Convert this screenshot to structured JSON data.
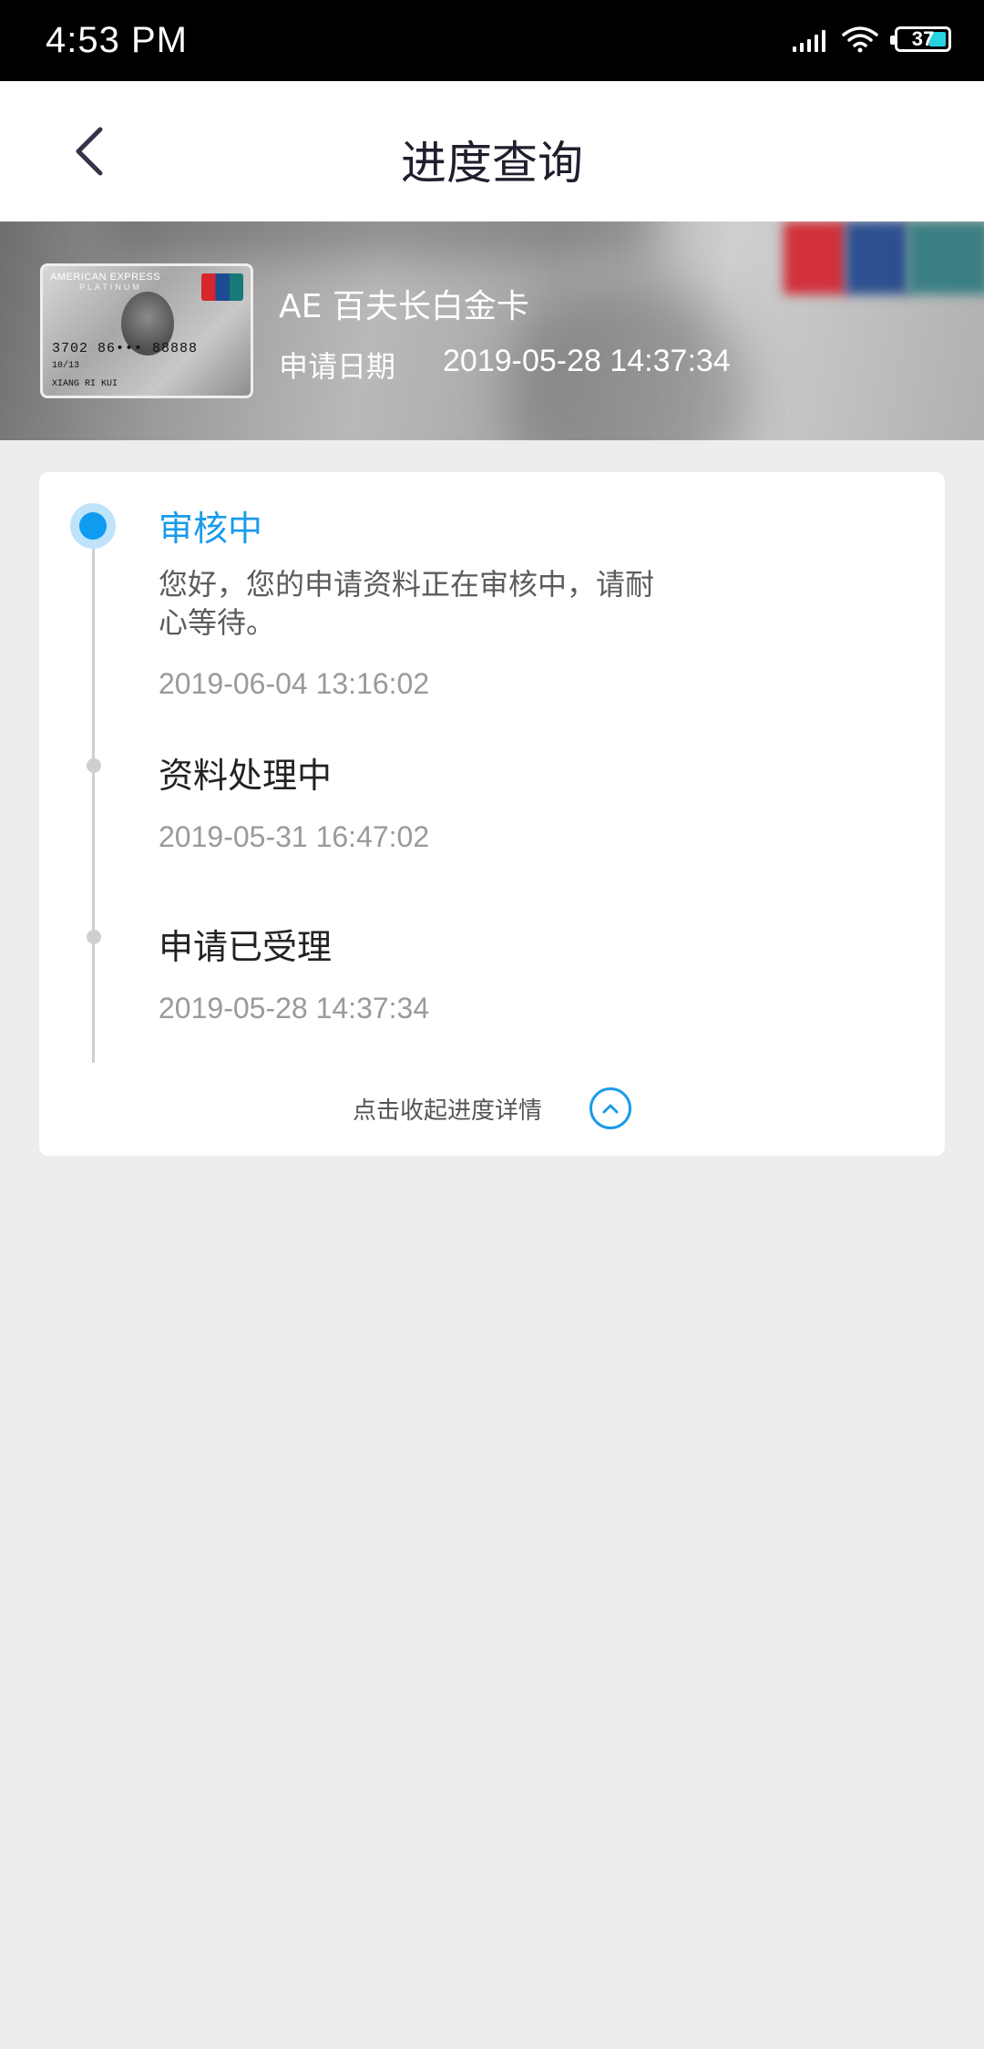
{
  "status_bar": {
    "time": "4:53 PM",
    "battery": "37",
    "icons": [
      "signal-icon",
      "wifi-icon",
      "battery-icon"
    ]
  },
  "nav": {
    "title": "进度查询",
    "back_icon": "chevron-left-icon"
  },
  "card": {
    "name": "AE 百夫长白金卡",
    "date_label": "申请日期",
    "date_value": "2019-05-28 14:37:34",
    "image": {
      "brand": "AMERICAN EXPRESS",
      "tier": "PLATINUM",
      "number": "3702 86••• 88888",
      "expiry": "10/13",
      "holder": "XIANG RI KUI"
    }
  },
  "progress": {
    "steps": [
      {
        "title": "审核中",
        "description": "您好，您的申请资料正在审核中，请耐心等待。",
        "time": "2019-06-04 13:16:02",
        "active": true
      },
      {
        "title": "资料处理中",
        "time": "2019-05-31 16:47:02",
        "active": false
      },
      {
        "title": "申请已受理",
        "time": "2019-05-28 14:37:34",
        "active": false
      }
    ],
    "collapse_label": "点击收起进度详情",
    "collapse_icon": "chevron-up-circle-icon"
  },
  "colors": {
    "accent": "#1a9be9",
    "background": "#ededed"
  }
}
